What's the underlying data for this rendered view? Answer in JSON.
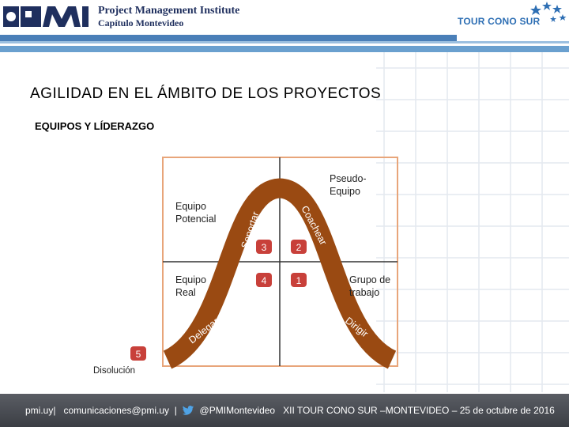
{
  "header": {
    "org_name": "Project Management Institute",
    "chapter": "Capítulo Montevideo",
    "tour_name": "TOUR CONO SUR",
    "colors": {
      "brand_blue": "#1f2f5e",
      "stripe": "#4a7fb8",
      "tour_blue": "#2e6fb4"
    }
  },
  "slide": {
    "title": "AGILIDAD EN EL ÁMBITO DE LOS PROYECTOS",
    "subtitle": "EQUIPOS Y LÍDERAZGO"
  },
  "diagram": {
    "quadrants": {
      "top_left": [
        "Equipo",
        "Potencial"
      ],
      "top_right": [
        "Pseudo-",
        "Equipo"
      ],
      "bottom_left": [
        "Equipo",
        "Real"
      ],
      "bottom_right": [
        "Grupo de",
        "trabajo"
      ]
    },
    "curve_labels": {
      "soportar": "Soportar",
      "coachear": "Coachear",
      "delegar": "Delegar",
      "dirigir": "Dirigir"
    },
    "markers": [
      {
        "id": "1",
        "label": "1"
      },
      {
        "id": "2",
        "label": "2"
      },
      {
        "id": "3",
        "label": "3"
      },
      {
        "id": "4",
        "label": "4"
      },
      {
        "id": "5",
        "label": "5"
      }
    ],
    "dissolution_label": "Disolución",
    "colors": {
      "curve": "#9a4a12",
      "frame": "#e8a57a",
      "marker": "#c8403a"
    }
  },
  "footer": {
    "site": "pmi.uy|",
    "email": "comunicaciones@pmi.uy",
    "separator": "|",
    "twitter": "@PMIMontevideo",
    "event": "XII TOUR CONO SUR –MONTEVIDEO – 25 de octubre de 2016"
  }
}
